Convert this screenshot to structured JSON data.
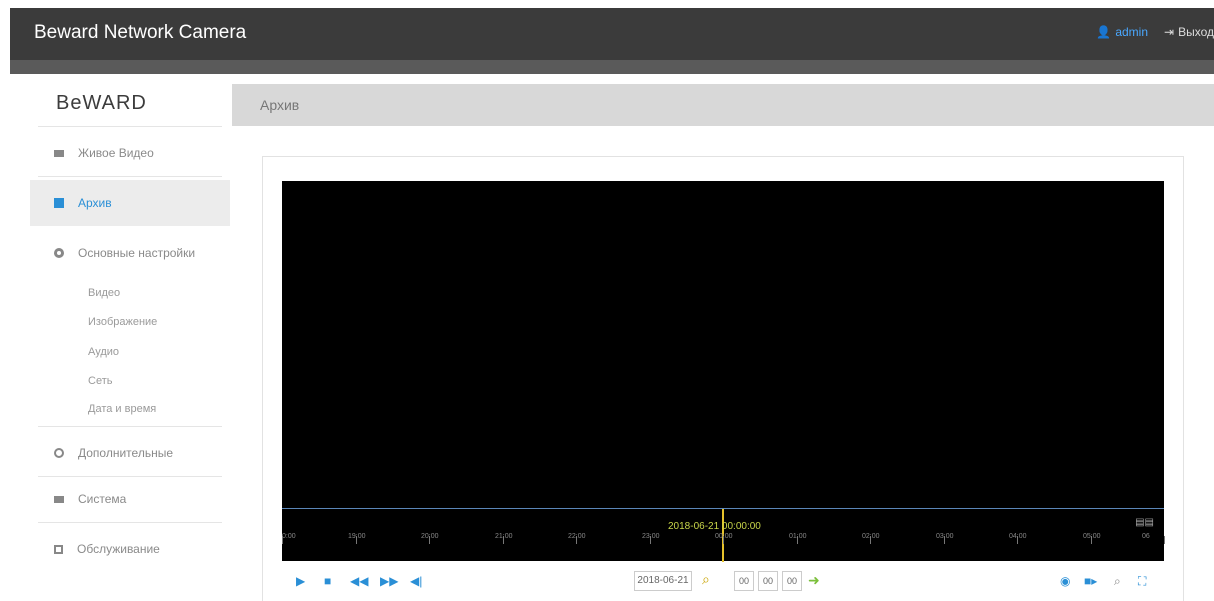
{
  "app": {
    "title": "Beward Network Camera",
    "user": "admin",
    "logout": "Выход"
  },
  "sidebar": {
    "logo": "BeWARD",
    "items": [
      {
        "label": "Живое Видео",
        "icon": "camera-icon"
      },
      {
        "label": "Архив",
        "icon": "archive-icon",
        "active": true
      },
      {
        "label": "Основные настройки",
        "icon": "gear-icon"
      },
      {
        "label": "Дополнительные",
        "icon": "settings-icon"
      },
      {
        "label": "Система",
        "icon": "monitor-icon"
      },
      {
        "label": "Обслуживание",
        "icon": "maintenance-icon"
      }
    ],
    "subitems": [
      "Видео",
      "Изображение",
      "Аудио",
      "Сеть",
      "Дата и время"
    ]
  },
  "page": {
    "title": "Архив"
  },
  "player": {
    "timeline": {
      "current": "2018-06-21 00:00:00",
      "labels": [
        "0:00",
        "19:00",
        "20:00",
        "21:00",
        "22:00",
        "23:00",
        "00:00",
        "01:00",
        "02:00",
        "03:00",
        "04:00",
        "05:00",
        "06"
      ]
    },
    "controls": {
      "date": "2018-06-21",
      "hour": "00",
      "minute": "00",
      "second": "00"
    }
  },
  "colors": {
    "accent": "#2a8fd6",
    "topbar": "#3b3b3b",
    "cursor": "#e6c22b"
  }
}
